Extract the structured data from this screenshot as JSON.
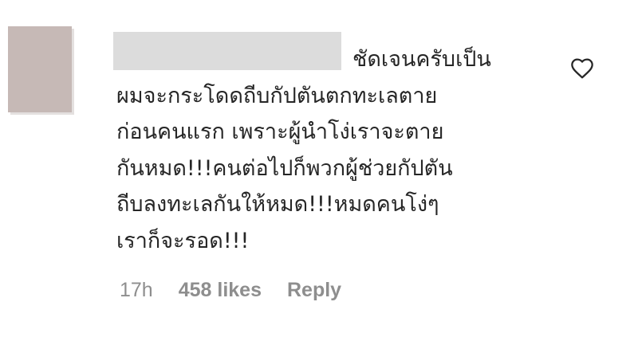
{
  "comment": {
    "lines": [
      "ชัดเจนครับเป็น",
      "ผมจะกระโดดถีบกัปตันตกทะเลตาย",
      "ก่อนคนแรก เพราะผู้นำโง่เราจะตาย",
      "กันหมด!!!คนต่อไปก็พวกผู้ช่วยกัปตัน",
      "ถีบลงทะเลกันให้หมด!!!หมดคนโง่ๆ",
      "เราก็จะรอด!!!"
    ]
  },
  "meta": {
    "time": "17h",
    "likes": "458 likes",
    "reply": "Reply"
  },
  "icons": {
    "like": "heart-outline-icon"
  },
  "colors": {
    "text": "#262626",
    "meta": "#8e8e8e",
    "avatar": "#c6b9b6",
    "redaction": "#dcdcdc"
  }
}
